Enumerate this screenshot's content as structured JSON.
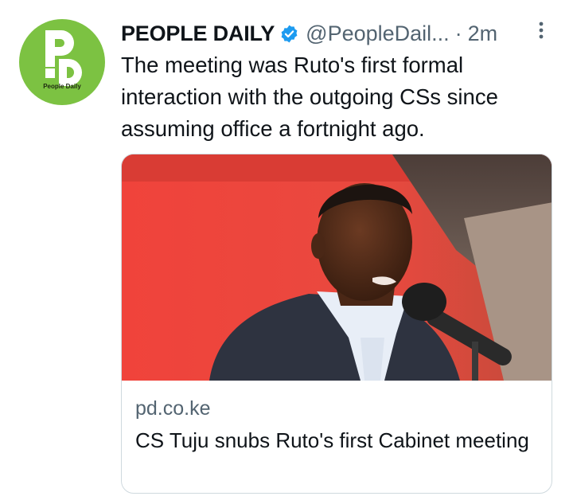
{
  "tweet": {
    "author": {
      "display_name": "PEOPLE DAILY",
      "handle": "@PeopleDail...",
      "verified": true,
      "avatar_logo_text": "People Daily"
    },
    "separator": "·",
    "timestamp": "2m",
    "text": "The meeting was Ruto's first formal interaction with the outgoing CSs since assuming office a fortnight ago.",
    "card": {
      "domain": "pd.co.ke",
      "title": "CS Tuju snubs Ruto's first Cabinet meeting"
    }
  },
  "colors": {
    "brand_green": "#7cc242",
    "verified_blue": "#1d9bf0",
    "muted_text": "#536471",
    "border": "#cfd9de"
  },
  "icons": {
    "verified": "verified-badge-icon",
    "more": "more-options-icon"
  }
}
